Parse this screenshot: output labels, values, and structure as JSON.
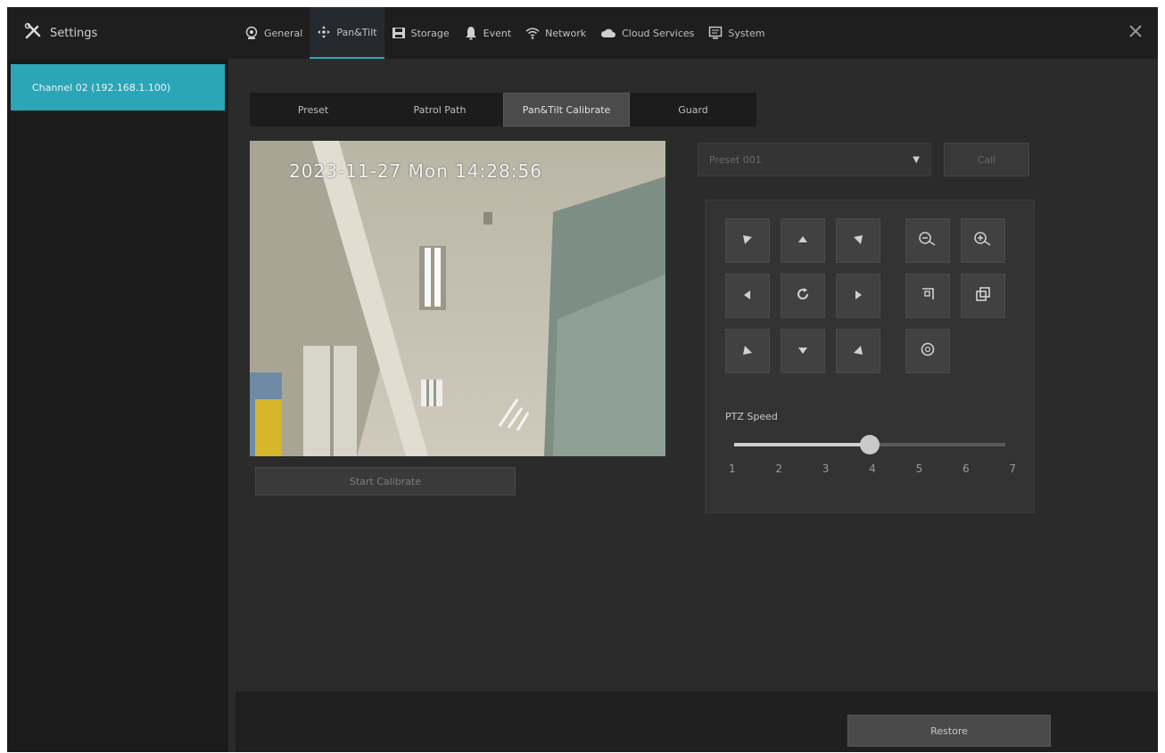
{
  "app": {
    "title": "Settings",
    "nav": [
      {
        "id": "general",
        "label": "General",
        "icon": "camera-icon"
      },
      {
        "id": "ptz",
        "label": "Pan&Tilt",
        "icon": "ptz-icon"
      },
      {
        "id": "storage",
        "label": "Storage",
        "icon": "storage-icon"
      },
      {
        "id": "event",
        "label": "Event",
        "icon": "event-icon"
      },
      {
        "id": "network",
        "label": "Network",
        "icon": "wifi-icon"
      },
      {
        "id": "cloud",
        "label": "Cloud Services",
        "icon": "cloud-icon"
      },
      {
        "id": "system",
        "label": "System",
        "icon": "monitor-icon"
      }
    ],
    "active_nav": "ptz"
  },
  "sidebar": {
    "channel_label": "Channel 02 (192.168.1.100)"
  },
  "subtabs": [
    "Preset",
    "Patrol Path",
    "Pan&Tilt Calibrate",
    "Guard"
  ],
  "active_subtab": 2,
  "video": {
    "osd_text": "2023-11-27 Mon 14:28:56"
  },
  "start_button_label": "Start Calibrate",
  "preset_select": {
    "value": "Preset 001"
  },
  "call_button_label": "Call",
  "ptz": {
    "speed_label": "PTZ Speed",
    "speed_value": 4,
    "speed_min": 1,
    "speed_max": 7,
    "ticks": [
      "1",
      "2",
      "3",
      "4",
      "5",
      "6",
      "7"
    ]
  },
  "footer": {
    "restore_label": "Restore"
  },
  "colors": {
    "accent": "#2aa6b8",
    "background": "#2b2b2b",
    "sidebar": "#1b1b1b",
    "topbar": "#1e1e1e"
  }
}
